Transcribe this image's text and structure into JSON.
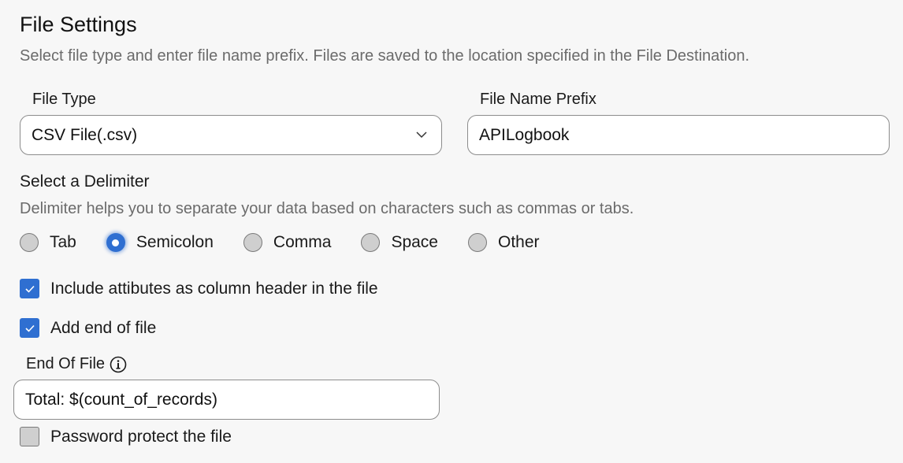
{
  "header": {
    "title": "File Settings",
    "subtitle": "Select file type and enter file name prefix. Files are saved to the location specified in the File Destination."
  },
  "file_type": {
    "label": "File Type",
    "value": "CSV File(.csv)",
    "icon": "chevron-down-icon"
  },
  "file_name_prefix": {
    "label": "File Name Prefix",
    "value": "APILogbook"
  },
  "delimiter": {
    "title": "Select a Delimiter",
    "description": "Delimiter helps you to separate your data based on characters such as commas or tabs.",
    "options": [
      {
        "label": "Tab",
        "checked": false
      },
      {
        "label": "Semicolon",
        "checked": true
      },
      {
        "label": "Comma",
        "checked": false
      },
      {
        "label": "Space",
        "checked": false
      },
      {
        "label": "Other",
        "checked": false
      }
    ],
    "selected": "Semicolon"
  },
  "checkboxes": {
    "include_header": {
      "label": "Include attibutes as column header in the file",
      "checked": true
    },
    "add_end_of_file": {
      "label": "Add end of file",
      "checked": true
    },
    "password_protect": {
      "label": "Password protect the file",
      "checked": false
    }
  },
  "end_of_file": {
    "label": "End Of File",
    "icon": "info-icon",
    "value": "Total: $(count_of_records)"
  },
  "colors": {
    "accent": "#2f6fd1",
    "background": "#f7f7f7",
    "muted_text": "#6b6b6b"
  }
}
